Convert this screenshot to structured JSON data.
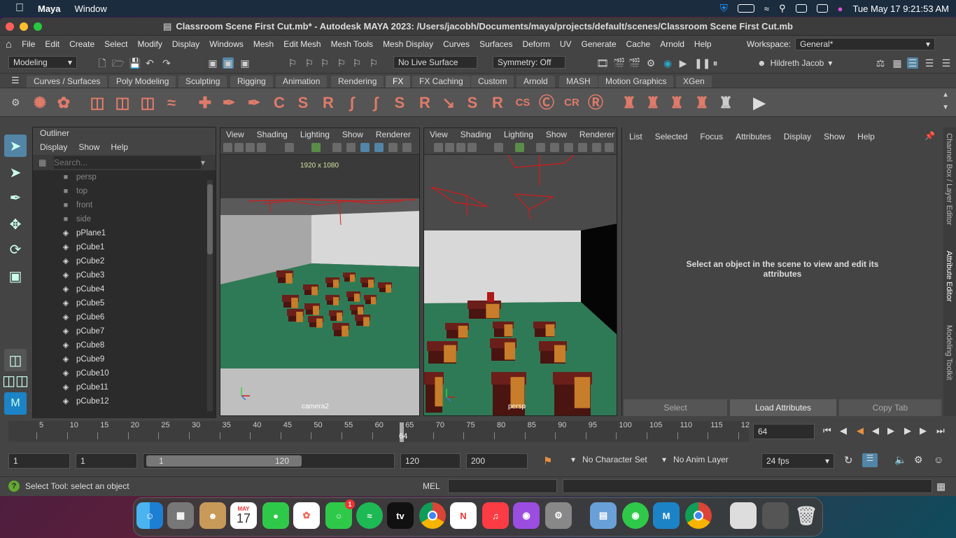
{
  "menubar": {
    "app": "Maya",
    "items": [
      "Window"
    ],
    "datetime": "Tue May 17  9:21:53 AM"
  },
  "window": {
    "title": "Classroom Scene First Cut.mb* - Autodesk MAYA 2023: /Users/jacobh/Documents/maya/projects/default/scenes/Classroom Scene First Cut.mb"
  },
  "maya_menu": {
    "items": [
      "File",
      "Edit",
      "Create",
      "Select",
      "Modify",
      "Display",
      "Windows",
      "Mesh",
      "Edit Mesh",
      "Mesh Tools",
      "Mesh Display",
      "Curves",
      "Surfaces",
      "Deform",
      "UV",
      "Generate",
      "Cache",
      "Arnold",
      "Help"
    ],
    "workspace_label": "Workspace:",
    "workspace_value": "General*"
  },
  "status_line": {
    "mode": "Modeling",
    "live_surface": "No Live Surface",
    "symmetry": "Symmetry: Off",
    "user": "Hildreth Jacob"
  },
  "shelf": {
    "tabs": [
      "Curves / Surfaces",
      "Poly Modeling",
      "Sculpting",
      "Rigging",
      "Animation",
      "Rendering",
      "FX",
      "FX Caching",
      "Custom",
      "Arnold",
      "MASH",
      "Motion Graphics",
      "XGen"
    ],
    "active_tab": "FX"
  },
  "outliner": {
    "title": "Outliner",
    "menu": [
      "Display",
      "Show",
      "Help"
    ],
    "search_placeholder": "Search...",
    "items": [
      {
        "name": "persp",
        "type": "camera"
      },
      {
        "name": "top",
        "type": "camera"
      },
      {
        "name": "front",
        "type": "camera"
      },
      {
        "name": "side",
        "type": "camera"
      },
      {
        "name": "pPlane1",
        "type": "mesh"
      },
      {
        "name": "pCube1",
        "type": "mesh"
      },
      {
        "name": "pCube2",
        "type": "mesh"
      },
      {
        "name": "pCube3",
        "type": "mesh"
      },
      {
        "name": "pCube4",
        "type": "mesh"
      },
      {
        "name": "pCube5",
        "type": "mesh"
      },
      {
        "name": "pCube6",
        "type": "mesh"
      },
      {
        "name": "pCube7",
        "type": "mesh"
      },
      {
        "name": "pCube8",
        "type": "mesh"
      },
      {
        "name": "pCube9",
        "type": "mesh"
      },
      {
        "name": "pCube10",
        "type": "mesh"
      },
      {
        "name": "pCube11",
        "type": "mesh"
      },
      {
        "name": "pCube12",
        "type": "mesh"
      }
    ]
  },
  "viewport_left": {
    "menu": [
      "View",
      "Shading",
      "Lighting",
      "Show",
      "Renderer"
    ],
    "resolution": "1920 x 1080",
    "camera": "camera2"
  },
  "viewport_right": {
    "menu": [
      "View",
      "Shading",
      "Lighting",
      "Show",
      "Renderer"
    ],
    "camera": "persp"
  },
  "attribute_editor": {
    "menu": [
      "List",
      "Selected",
      "Focus",
      "Attributes",
      "Display",
      "Show",
      "Help"
    ],
    "message": "Select an object in the scene to view and edit its attributes",
    "buttons": [
      "Select",
      "Load Attributes",
      "Copy Tab"
    ],
    "side_tabs": [
      "Channel Box / Layer Editor",
      "Attribute Editor",
      "Modeling Toolkit"
    ]
  },
  "time_slider": {
    "ticks": [
      "5",
      "10",
      "15",
      "20",
      "25",
      "30",
      "35",
      "40",
      "45",
      "50",
      "55",
      "60",
      "65",
      "70",
      "75",
      "80",
      "85",
      "90",
      "95",
      "100",
      "105",
      "110",
      "115",
      "12"
    ],
    "current_frame": "64",
    "current_field": "64"
  },
  "range_slider": {
    "start": "1",
    "anim_start": "1",
    "range_start": "1",
    "range_end": "120",
    "end": "120",
    "anim_end": "200",
    "character_set": "No Character Set",
    "anim_layer": "No Anim Layer",
    "fps": "24 fps"
  },
  "command_line": {
    "help_text": "Select Tool: select an object",
    "lang": "MEL"
  },
  "dock": {
    "calendar_month": "MAY",
    "calendar_day": "17",
    "messages_badge": "1",
    "maya_label": "M"
  },
  "colors": {
    "accent": "#5285a6",
    "shelf_icon": "#e07b6a",
    "floor": "#2f7a56",
    "desk": "#6b1f1a",
    "chair": "#c77d2a",
    "camera_lines": "#d51a1a"
  }
}
